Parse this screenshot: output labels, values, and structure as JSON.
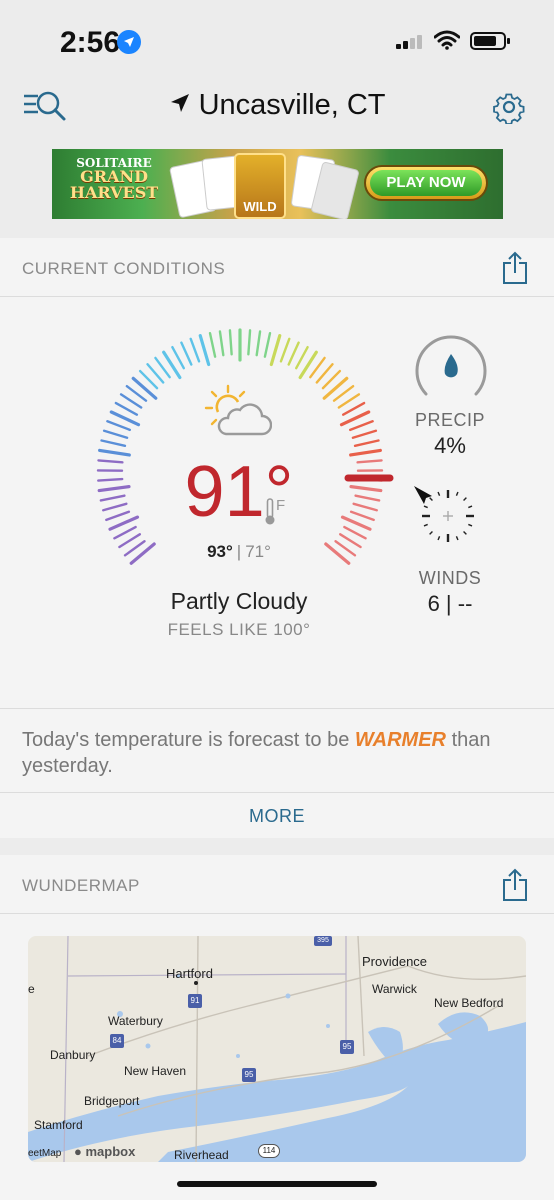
{
  "status_bar": {
    "time": "2:56"
  },
  "header": {
    "location": "Uncasville, CT"
  },
  "ad": {
    "title_line1": "SOLITAIRE",
    "title_line2": "GRAND",
    "title_line3": "HARVEST",
    "card_label": "WILD",
    "cta": "PLAY NOW"
  },
  "current_conditions": {
    "section_title": "CURRENT CONDITIONS",
    "temperature": "91°",
    "unit": "F",
    "high": "93°",
    "low": "71°",
    "condition": "Partly Cloudy",
    "feels_like": "FEELS LIKE 100°",
    "precip_label": "PRECIP",
    "precip_value": "4%",
    "winds_label": "WINDS",
    "winds_value": "6 | --",
    "forecast_text": "Today's temperature is forecast to be",
    "forecast_emphasis": "WARMER",
    "forecast_tail": "than yesterday.",
    "more_label": "MORE",
    "icon": "partly-cloudy-icon",
    "accent_color": "#c0272d"
  },
  "wundermap": {
    "section_title": "WUNDERMAP",
    "labels": {
      "hartford": "Hartford",
      "providence": "Providence",
      "warwick": "Warwick",
      "new_bedford": "New Bedford",
      "waterbury": "Waterbury",
      "danbury": "Danbury",
      "new_haven": "New Haven",
      "bridgeport": "Bridgeport",
      "stamford": "Stamford",
      "riverhead": "Riverhead",
      "mapbox": "mapbox",
      "streetmap": "eetMap",
      "edge_e": "e"
    },
    "shields": {
      "i91": "91",
      "i84": "84",
      "i95a": "95",
      "i95b": "95",
      "r114": "114",
      "i395": "395"
    }
  }
}
